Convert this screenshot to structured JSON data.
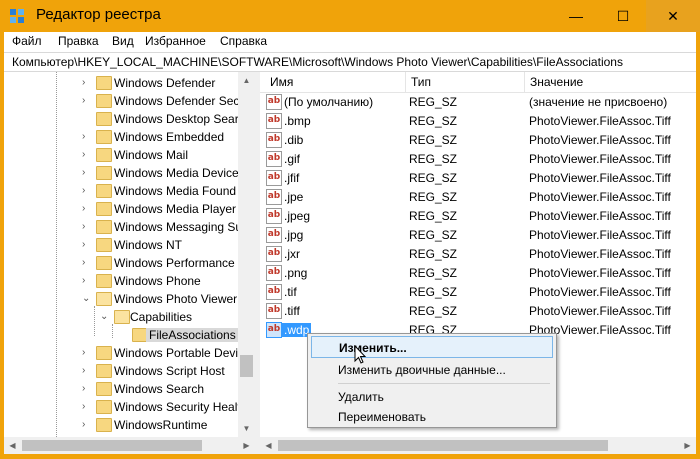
{
  "window": {
    "title": "Редактор реестра",
    "minimize_glyph": "—",
    "maximize_glyph": "☐",
    "close_glyph": "✕",
    "accent": "#f0a30a"
  },
  "menu": [
    "Файл",
    "Правка",
    "Вид",
    "Избранное",
    "Справка"
  ],
  "address": "Компьютер\\HKEY_LOCAL_MACHINE\\SOFTWARE\\Microsoft\\Windows Photo Viewer\\Capabilities\\FileAssociations",
  "tree": [
    {
      "label": "Windows Defender",
      "expander": "›",
      "open": false
    },
    {
      "label": "Windows Defender Secu",
      "expander": "›",
      "open": false
    },
    {
      "label": "Windows Desktop Searc",
      "expander": "",
      "open": false
    },
    {
      "label": "Windows Embedded",
      "expander": "›",
      "open": false
    },
    {
      "label": "Windows Mail",
      "expander": "›",
      "open": false
    },
    {
      "label": "Windows Media Device",
      "expander": "›",
      "open": false
    },
    {
      "label": "Windows Media Found",
      "expander": "›",
      "open": false
    },
    {
      "label": "Windows Media Player",
      "expander": "›",
      "open": false
    },
    {
      "label": "Windows Messaging Su",
      "expander": "›",
      "open": false
    },
    {
      "label": "Windows NT",
      "expander": "›",
      "open": false
    },
    {
      "label": "Windows Performance",
      "expander": "›",
      "open": false
    },
    {
      "label": "Windows Phone",
      "expander": "›",
      "open": false
    },
    {
      "label": "Windows Photo Viewer",
      "expander": "⌄",
      "open": true
    },
    {
      "label": "Capabilities",
      "expander": "⌄",
      "open": true
    },
    {
      "label": "FileAssociations",
      "expander": "",
      "open": false,
      "selected": true
    },
    {
      "label": "Windows Portable Devi",
      "expander": "›",
      "open": false
    },
    {
      "label": "Windows Script Host",
      "expander": "›",
      "open": false
    },
    {
      "label": "Windows Search",
      "expander": "›",
      "open": false
    },
    {
      "label": "Windows Security Healt",
      "expander": "›",
      "open": false
    },
    {
      "label": "WindowsRuntime",
      "expander": "›",
      "open": false
    }
  ],
  "list": {
    "columns": [
      "Имя",
      "Тип",
      "Значение"
    ],
    "icon_text": "ab",
    "rows": [
      {
        "name": "(По умолчанию)",
        "type": "REG_SZ",
        "data": "(значение не присвоено)"
      },
      {
        "name": ".bmp",
        "type": "REG_SZ",
        "data": "PhotoViewer.FileAssoc.Tiff"
      },
      {
        "name": ".dib",
        "type": "REG_SZ",
        "data": "PhotoViewer.FileAssoc.Tiff"
      },
      {
        "name": ".gif",
        "type": "REG_SZ",
        "data": "PhotoViewer.FileAssoc.Tiff"
      },
      {
        "name": ".jfif",
        "type": "REG_SZ",
        "data": "PhotoViewer.FileAssoc.Tiff"
      },
      {
        "name": ".jpe",
        "type": "REG_SZ",
        "data": "PhotoViewer.FileAssoc.Tiff"
      },
      {
        "name": ".jpeg",
        "type": "REG_SZ",
        "data": "PhotoViewer.FileAssoc.Tiff"
      },
      {
        "name": ".jpg",
        "type": "REG_SZ",
        "data": "PhotoViewer.FileAssoc.Tiff"
      },
      {
        "name": ".jxr",
        "type": "REG_SZ",
        "data": "PhotoViewer.FileAssoc.Tiff"
      },
      {
        "name": ".png",
        "type": "REG_SZ",
        "data": "PhotoViewer.FileAssoc.Tiff"
      },
      {
        "name": ".tif",
        "type": "REG_SZ",
        "data": "PhotoViewer.FileAssoc.Tiff"
      },
      {
        "name": ".tiff",
        "type": "REG_SZ",
        "data": "PhotoViewer.FileAssoc.Tiff"
      },
      {
        "name": ".wdp",
        "type": "REG_SZ",
        "data": "PhotoViewer.FileAssoc.Tiff",
        "selected": true
      }
    ]
  },
  "context_menu": {
    "modify": "Изменить...",
    "modify_binary": "Изменить двоичные данные...",
    "delete": "Удалить",
    "rename": "Переименовать"
  },
  "scroll": {
    "up": "▲",
    "down": "▼",
    "left": "◀",
    "right": "▶",
    "grip": "|||"
  }
}
